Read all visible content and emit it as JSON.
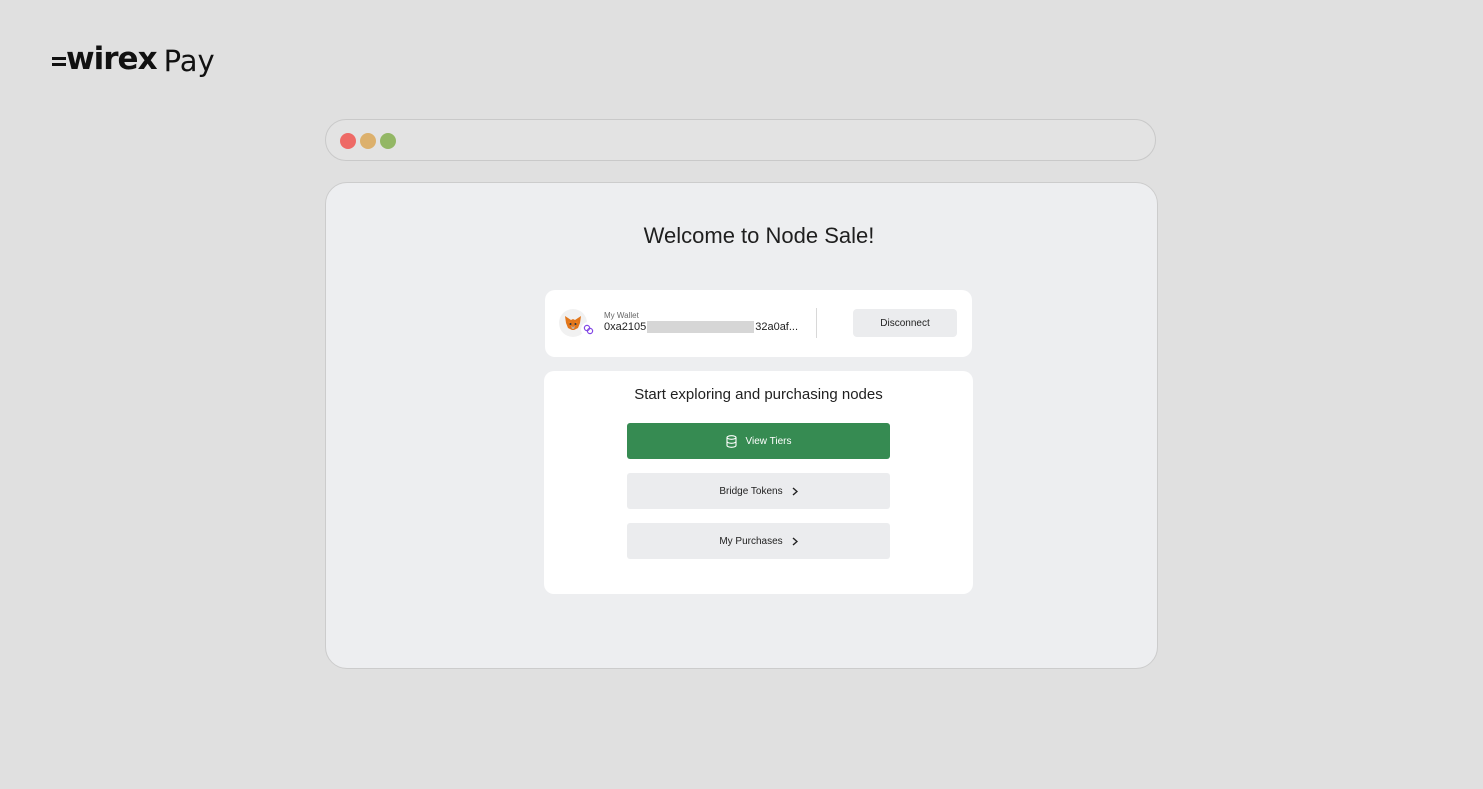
{
  "brand": {
    "name": "wirex",
    "product": "Pay"
  },
  "window_controls": {
    "close": "#ee6a66",
    "minimize": "#dcb06c",
    "maximize": "#93b765"
  },
  "page": {
    "title": "Welcome to Node Sale!"
  },
  "wallet": {
    "label": "My Wallet",
    "address_prefix": "0xa2105",
    "address_suffix": "32a0af...",
    "disconnect_label": "Disconnect"
  },
  "actions": {
    "heading": "Start exploring and purchasing nodes",
    "view_tiers_label": "View Tiers",
    "bridge_tokens_label": "Bridge Tokens",
    "my_purchases_label": "My Purchases"
  },
  "icons": {
    "wallet": "fox-icon",
    "chain": "chain-link-icon",
    "view_tiers": "coins-stack-icon",
    "chevron": "chevron-right-icon"
  },
  "colors": {
    "primary_button": "#368b52",
    "background": "#e0e0e0",
    "window_background": "#edeef0",
    "card_background": "#ffffff"
  }
}
